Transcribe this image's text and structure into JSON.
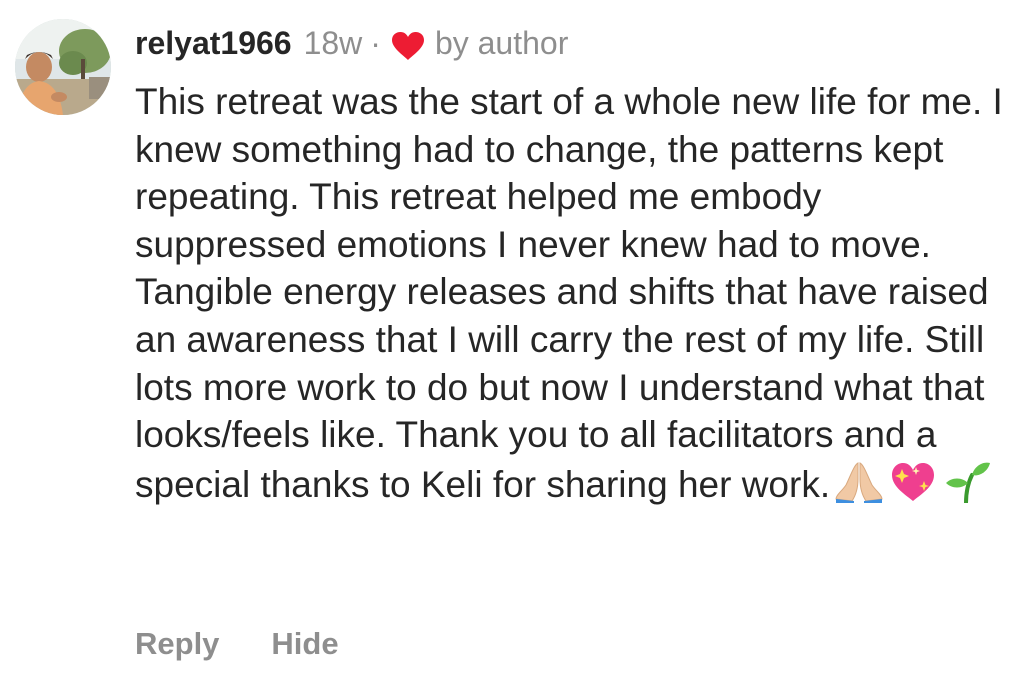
{
  "comment": {
    "username": "relyat1966",
    "age": "18w",
    "separator": "·",
    "liked_by": "by author",
    "text": "This retreat was the start of a whole new life for me. I knew something had to change, the patterns kept repeating. This retreat helped me embody suppressed emotions I never knew had to move. Tangible energy releases and shifts that have raised an awareness that I will carry the rest of my life. Still lots more work to do but now I understand what that looks/feels like. Thank you to all facilitators and a special thanks to Keli for sharing her work.",
    "emojis": [
      "folded-hands-emoji",
      "sparkling-heart-emoji",
      "seedling-emoji"
    ],
    "actions": {
      "reply": "Reply",
      "hide": "Hide"
    }
  },
  "colors": {
    "text": "#262626",
    "secondary": "#8e8e8e",
    "heart": "#ed1c33"
  }
}
